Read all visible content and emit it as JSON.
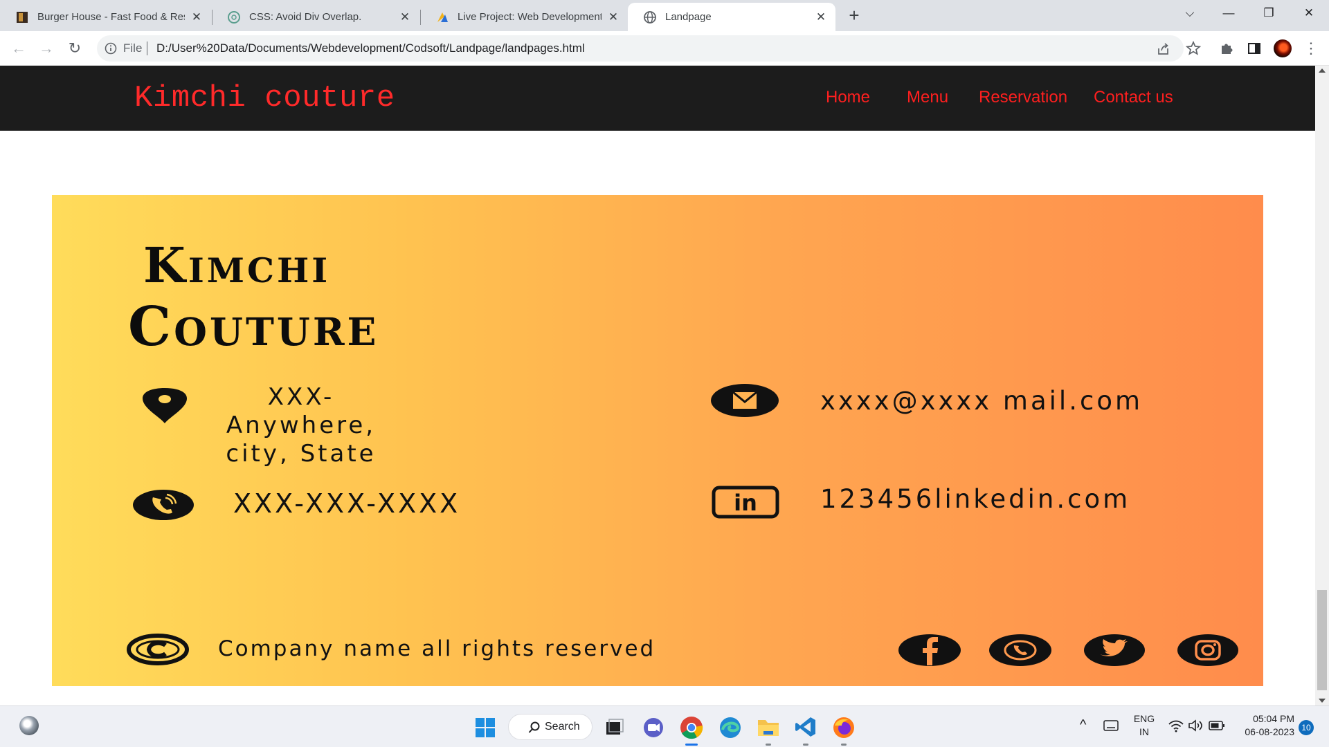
{
  "browser": {
    "tabs": [
      {
        "title": "Burger House - Fast Food & Rest",
        "favicon": "burger-favicon"
      },
      {
        "title": "CSS: Avoid Div Overlap.",
        "favicon": "chatgpt-favicon"
      },
      {
        "title": "Live Project: Web Development -",
        "favicon": "project-favicon"
      },
      {
        "title": "Landpage",
        "favicon": "globe-favicon",
        "active": true
      }
    ],
    "address": {
      "scheme_label": "File",
      "url": "D:/User%20Data/Documents/Webdevelopment/Codsoft/Landpage/landpages.html"
    }
  },
  "site": {
    "brand": "Kimchi couture",
    "nav": [
      "Home",
      "Menu",
      "Reservation",
      "Contact us"
    ],
    "brand_color": "#ff2a2a"
  },
  "card": {
    "title_line1": "Kimchi",
    "title_line2": "Couture",
    "address_lines": [
      "XXX-",
      "Anywhere,",
      "city, State"
    ],
    "phone": "XXX-XXX-XXXX",
    "email": "xxxx@xxxx mail.com",
    "linkedin": "123456linkedin.com",
    "copyright": "Company name all rights reserved",
    "gradient": [
      "#ffdc5a",
      "#ff8c4c"
    ],
    "social_icons": [
      "facebook-icon",
      "whatsapp-icon",
      "twitter-icon",
      "instagram-icon"
    ]
  },
  "taskbar": {
    "search_label": "Search",
    "lang": "ENG",
    "region": "IN",
    "time": "05:04 PM",
    "date": "06-08-2023",
    "notification_count": "10"
  }
}
